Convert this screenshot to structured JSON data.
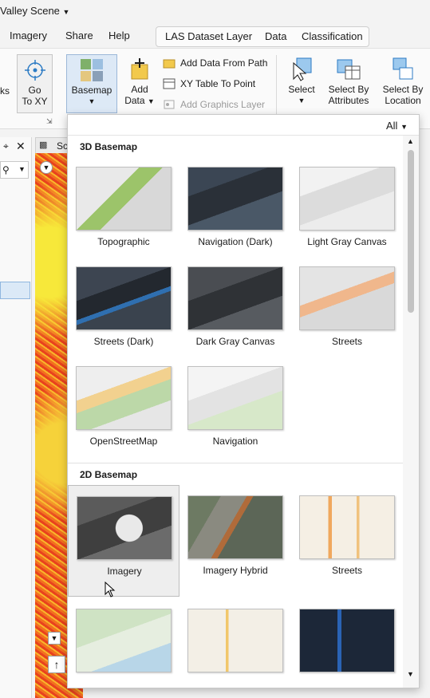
{
  "window": {
    "title": "Valley Scene"
  },
  "tabs": {
    "items": [
      "Imagery",
      "Share",
      "Help"
    ],
    "contextual": [
      "LAS Dataset Layer",
      "Data",
      "Classification"
    ]
  },
  "ribbon": {
    "partial_label": "ks",
    "goto": {
      "line1": "Go",
      "line2": "To XY"
    },
    "basemap": {
      "label": "Basemap"
    },
    "add_data": {
      "line1": "Add",
      "line2": "Data"
    },
    "add_data_path": "Add Data From Path",
    "xy_table": "XY Table To Point",
    "add_graphics": "Add Graphics Layer",
    "select": "Select",
    "select_attr": {
      "line1": "Select By",
      "line2": "Attributes"
    },
    "select_loc": {
      "line1": "Select By",
      "line2": "Location"
    }
  },
  "map": {
    "tab_partial": "Sc"
  },
  "gallery": {
    "filter": "All",
    "section3d": "3D Basemap",
    "section2d": "2D Basemap",
    "items3d": [
      "Topographic",
      "Navigation (Dark)",
      "Light Gray Canvas",
      "Streets (Dark)",
      "Dark Gray Canvas",
      "Streets",
      "OpenStreetMap",
      "Navigation"
    ],
    "items2d": [
      "Imagery",
      "Imagery Hybrid",
      "Streets"
    ],
    "selected": "Imagery"
  },
  "colors": {
    "accent": "#2c7bc4"
  }
}
